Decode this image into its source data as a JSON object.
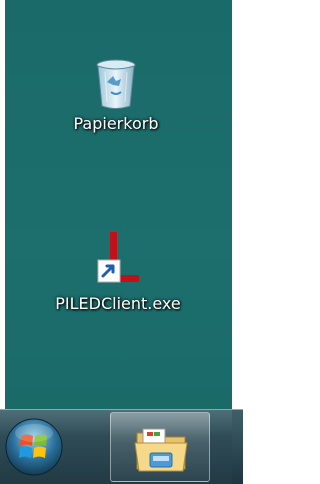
{
  "desktop": {
    "background_color": "#1b6d6b",
    "icons": [
      {
        "label": "Papierkorb",
        "icon": "recycle-bin-icon"
      },
      {
        "label": "PILEDClient.exe",
        "icon": "piled-client-shortcut-icon"
      }
    ]
  },
  "taskbar": {
    "start_button_icon": "windows-start-orb-icon",
    "pinned": [
      {
        "icon": "windows-explorer-folder-icon"
      }
    ]
  }
}
